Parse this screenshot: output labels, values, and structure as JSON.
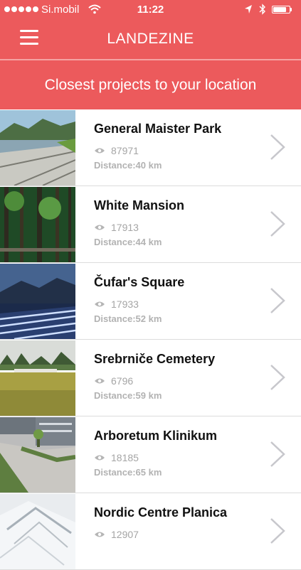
{
  "statusbar": {
    "carrier": "Si.mobil",
    "time": "11:22",
    "battery_level": 0.85,
    "icons": [
      "signal-dots-icon",
      "wifi-icon",
      "location-arrow-icon",
      "bluetooth-icon",
      "battery-icon"
    ]
  },
  "header": {
    "title": "LANDEZINE",
    "menu_icon": "hamburger-menu-icon"
  },
  "subheader": {
    "text": "Closest projects to your location"
  },
  "projects": [
    {
      "title": "General Maister Park",
      "views": "87971",
      "distance": "Distance:40 km"
    },
    {
      "title": "White Mansion",
      "views": "17913",
      "distance": "Distance:44 km"
    },
    {
      "title": "Čufar's Square",
      "views": "17933",
      "distance": "Distance:52 km"
    },
    {
      "title": "Srebrniče Cemetery",
      "views": "6796",
      "distance": "Distance:59 km"
    },
    {
      "title": "Arboretum Klinikum",
      "views": "18185",
      "distance": "Distance:65 km"
    },
    {
      "title": "Nordic Centre Planica",
      "views": "12907",
      "distance": ""
    }
  ],
  "colors": {
    "accent": "#ec5a5c",
    "title_text": "#111111",
    "secondary_text": "#a5a5a5",
    "chevron": "#c7c7cc"
  }
}
